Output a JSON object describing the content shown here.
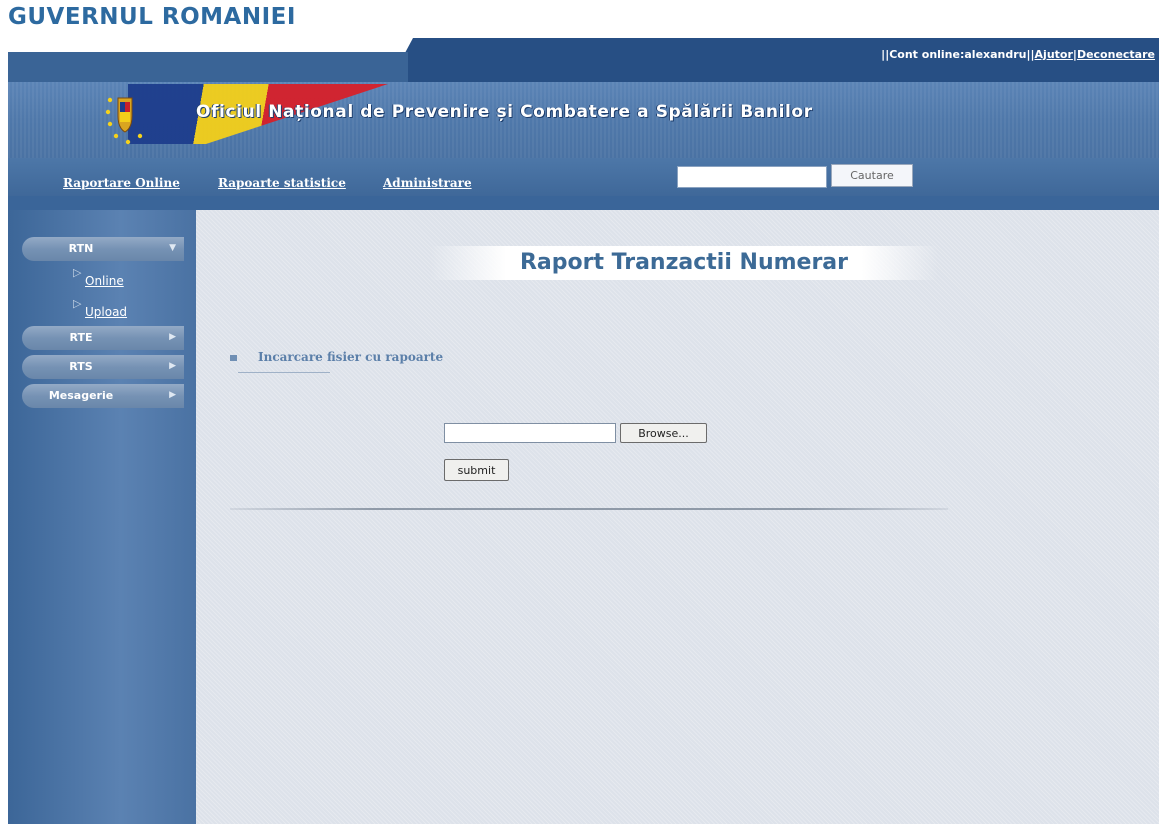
{
  "header": {
    "government": "GUVERNUL ROMANIEI",
    "agency": "Oficiul Național de Prevenire și Combatere a Spălării Banilor"
  },
  "account": {
    "prefix": "||Cont online:alexandru||",
    "help": "Ajutor",
    "separator": "|",
    "logout": "Deconectare"
  },
  "nav": {
    "items": [
      "Raportare Online",
      "Rapoarte statistice",
      "Administrare"
    ],
    "search_value": "",
    "search_button": "Cautare"
  },
  "sidebar": {
    "rtn": "RTN",
    "rtn_items": [
      "Online",
      "Upload"
    ],
    "rte": "RTE",
    "rts": "RTS",
    "mesagerie": "Mesagerie"
  },
  "main": {
    "title": "Raport Tranzactii Numerar",
    "section": "Incarcare fisier cu rapoarte",
    "file_value": "",
    "browse": "Browse...",
    "submit": "submit"
  },
  "colors": {
    "brand_blue": "#274f84",
    "title_blue": "#3c6a96",
    "heading_blue": "#2d6aa0"
  },
  "icons": {
    "rtn_arrow": "chevron-down-icon",
    "collapsed_arrow": "chevron-right-icon",
    "submenu_marker": "triangle-right-icon"
  }
}
